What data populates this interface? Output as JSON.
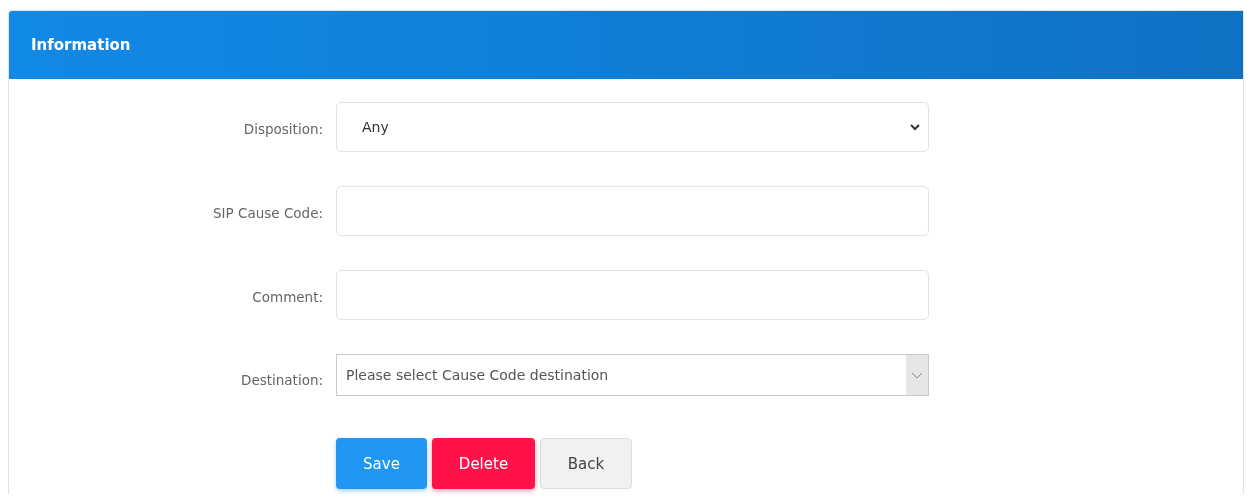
{
  "panel": {
    "title": "Information"
  },
  "fields": [
    {
      "label": "Disposition:",
      "kind": "select",
      "value": "Any"
    },
    {
      "label": "SIP Cause Code:",
      "kind": "text"
    },
    {
      "label": "Comment:",
      "kind": "text"
    },
    {
      "label": "Destination:",
      "kind": "combo",
      "placeholder": "Please select Cause Code destination"
    }
  ],
  "buttons": [
    {
      "label": "Save",
      "kind": "primary"
    },
    {
      "label": "Delete",
      "kind": "danger"
    },
    {
      "label": "Back",
      "kind": "default"
    }
  ]
}
